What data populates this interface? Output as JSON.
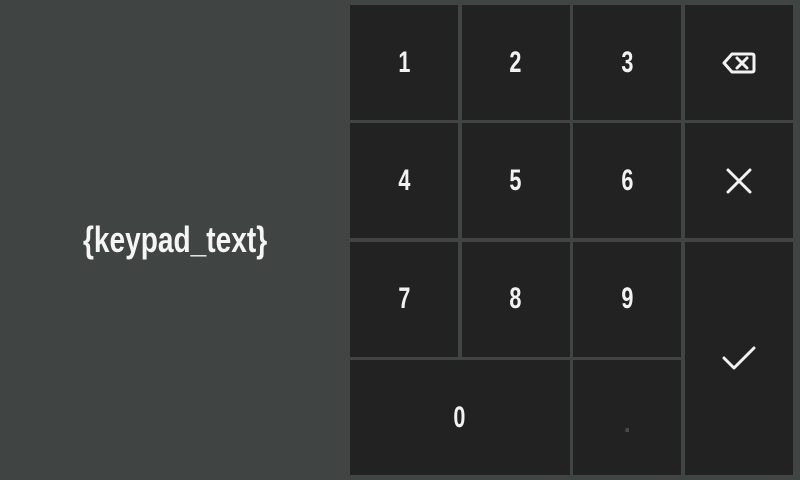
{
  "display": {
    "text": "{keypad_text}"
  },
  "keys": {
    "k1": "1",
    "k2": "2",
    "k3": "3",
    "k4": "4",
    "k5": "5",
    "k6": "6",
    "k7": "7",
    "k8": "8",
    "k9": "9",
    "k0": "0",
    "dot": "."
  },
  "icons": {
    "backspace": "backspace-icon",
    "clear": "close-icon",
    "ok": "checkmark-icon"
  },
  "colors": {
    "background": "#404442",
    "key": "#222222",
    "text": "#f2f2f2"
  }
}
